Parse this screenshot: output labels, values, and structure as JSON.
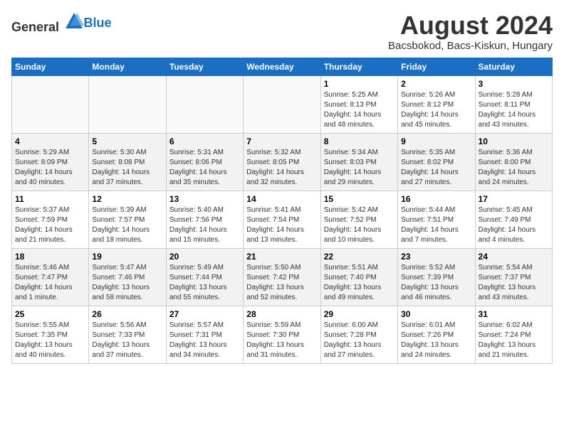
{
  "header": {
    "logo_general": "General",
    "logo_blue": "Blue",
    "title": "August 2024",
    "subtitle": "Bacsbokod, Bacs-Kiskun, Hungary"
  },
  "days_of_week": [
    "Sunday",
    "Monday",
    "Tuesday",
    "Wednesday",
    "Thursday",
    "Friday",
    "Saturday"
  ],
  "weeks": [
    [
      {
        "day": "",
        "detail": ""
      },
      {
        "day": "",
        "detail": ""
      },
      {
        "day": "",
        "detail": ""
      },
      {
        "day": "",
        "detail": ""
      },
      {
        "day": "1",
        "detail": "Sunrise: 5:25 AM\nSunset: 8:13 PM\nDaylight: 14 hours\nand 48 minutes."
      },
      {
        "day": "2",
        "detail": "Sunrise: 5:26 AM\nSunset: 8:12 PM\nDaylight: 14 hours\nand 45 minutes."
      },
      {
        "day": "3",
        "detail": "Sunrise: 5:28 AM\nSunset: 8:11 PM\nDaylight: 14 hours\nand 43 minutes."
      }
    ],
    [
      {
        "day": "4",
        "detail": "Sunrise: 5:29 AM\nSunset: 8:09 PM\nDaylight: 14 hours\nand 40 minutes."
      },
      {
        "day": "5",
        "detail": "Sunrise: 5:30 AM\nSunset: 8:08 PM\nDaylight: 14 hours\nand 37 minutes."
      },
      {
        "day": "6",
        "detail": "Sunrise: 5:31 AM\nSunset: 8:06 PM\nDaylight: 14 hours\nand 35 minutes."
      },
      {
        "day": "7",
        "detail": "Sunrise: 5:32 AM\nSunset: 8:05 PM\nDaylight: 14 hours\nand 32 minutes."
      },
      {
        "day": "8",
        "detail": "Sunrise: 5:34 AM\nSunset: 8:03 PM\nDaylight: 14 hours\nand 29 minutes."
      },
      {
        "day": "9",
        "detail": "Sunrise: 5:35 AM\nSunset: 8:02 PM\nDaylight: 14 hours\nand 27 minutes."
      },
      {
        "day": "10",
        "detail": "Sunrise: 5:36 AM\nSunset: 8:00 PM\nDaylight: 14 hours\nand 24 minutes."
      }
    ],
    [
      {
        "day": "11",
        "detail": "Sunrise: 5:37 AM\nSunset: 7:59 PM\nDaylight: 14 hours\nand 21 minutes."
      },
      {
        "day": "12",
        "detail": "Sunrise: 5:39 AM\nSunset: 7:57 PM\nDaylight: 14 hours\nand 18 minutes."
      },
      {
        "day": "13",
        "detail": "Sunrise: 5:40 AM\nSunset: 7:56 PM\nDaylight: 14 hours\nand 15 minutes."
      },
      {
        "day": "14",
        "detail": "Sunrise: 5:41 AM\nSunset: 7:54 PM\nDaylight: 14 hours\nand 13 minutes."
      },
      {
        "day": "15",
        "detail": "Sunrise: 5:42 AM\nSunset: 7:52 PM\nDaylight: 14 hours\nand 10 minutes."
      },
      {
        "day": "16",
        "detail": "Sunrise: 5:44 AM\nSunset: 7:51 PM\nDaylight: 14 hours\nand 7 minutes."
      },
      {
        "day": "17",
        "detail": "Sunrise: 5:45 AM\nSunset: 7:49 PM\nDaylight: 14 hours\nand 4 minutes."
      }
    ],
    [
      {
        "day": "18",
        "detail": "Sunrise: 5:46 AM\nSunset: 7:47 PM\nDaylight: 14 hours\nand 1 minute."
      },
      {
        "day": "19",
        "detail": "Sunrise: 5:47 AM\nSunset: 7:46 PM\nDaylight: 13 hours\nand 58 minutes."
      },
      {
        "day": "20",
        "detail": "Sunrise: 5:49 AM\nSunset: 7:44 PM\nDaylight: 13 hours\nand 55 minutes."
      },
      {
        "day": "21",
        "detail": "Sunrise: 5:50 AM\nSunset: 7:42 PM\nDaylight: 13 hours\nand 52 minutes."
      },
      {
        "day": "22",
        "detail": "Sunrise: 5:51 AM\nSunset: 7:40 PM\nDaylight: 13 hours\nand 49 minutes."
      },
      {
        "day": "23",
        "detail": "Sunrise: 5:52 AM\nSunset: 7:39 PM\nDaylight: 13 hours\nand 46 minutes."
      },
      {
        "day": "24",
        "detail": "Sunrise: 5:54 AM\nSunset: 7:37 PM\nDaylight: 13 hours\nand 43 minutes."
      }
    ],
    [
      {
        "day": "25",
        "detail": "Sunrise: 5:55 AM\nSunset: 7:35 PM\nDaylight: 13 hours\nand 40 minutes."
      },
      {
        "day": "26",
        "detail": "Sunrise: 5:56 AM\nSunset: 7:33 PM\nDaylight: 13 hours\nand 37 minutes."
      },
      {
        "day": "27",
        "detail": "Sunrise: 5:57 AM\nSunset: 7:31 PM\nDaylight: 13 hours\nand 34 minutes."
      },
      {
        "day": "28",
        "detail": "Sunrise: 5:59 AM\nSunset: 7:30 PM\nDaylight: 13 hours\nand 31 minutes."
      },
      {
        "day": "29",
        "detail": "Sunrise: 6:00 AM\nSunset: 7:28 PM\nDaylight: 13 hours\nand 27 minutes."
      },
      {
        "day": "30",
        "detail": "Sunrise: 6:01 AM\nSunset: 7:26 PM\nDaylight: 13 hours\nand 24 minutes."
      },
      {
        "day": "31",
        "detail": "Sunrise: 6:02 AM\nSunset: 7:24 PM\nDaylight: 13 hours\nand 21 minutes."
      }
    ]
  ]
}
